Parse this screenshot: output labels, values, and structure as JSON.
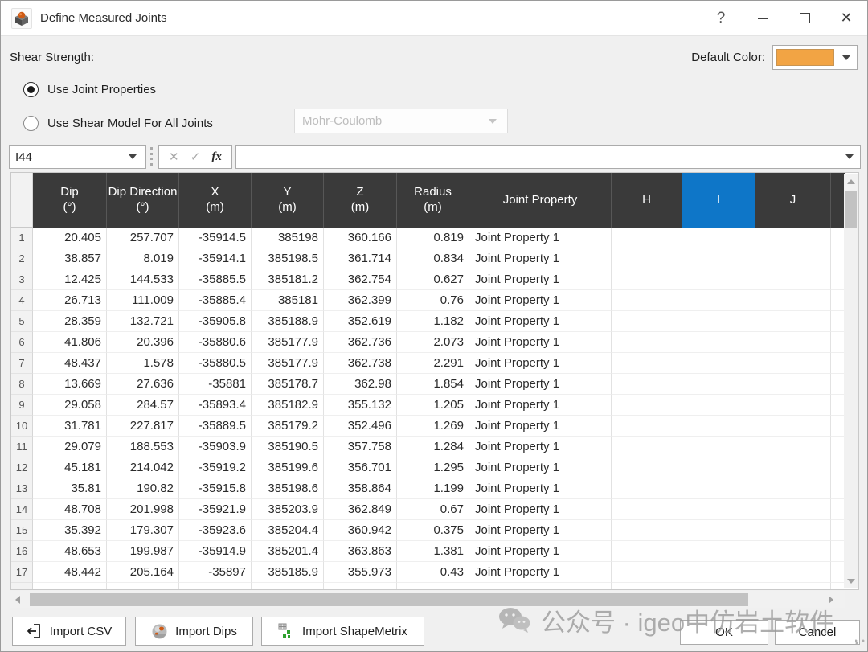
{
  "window": {
    "title": "Define Measured Joints",
    "icons": {
      "help_glyph": "?",
      "close_glyph": "✕",
      "cancel_glyph": "✕",
      "confirm_glyph": "✓"
    }
  },
  "header": {
    "shear_strength_label": "Shear Strength:",
    "default_color_label": "Default Color:",
    "default_color_hex": "#F2A444",
    "radio_use_joint_properties": {
      "label": "Use Joint Properties",
      "selected": true
    },
    "radio_use_shear_model": {
      "label": "Use Shear Model For All Joints",
      "selected": false
    },
    "shear_model_dropdown": {
      "value": "Mohr-Coulomb",
      "disabled": true
    }
  },
  "formula_row": {
    "name_box_value": "I44",
    "fx_label": "fx",
    "formula_bar_value": ""
  },
  "table": {
    "columns": [
      {
        "key": "dip",
        "label": "Dip",
        "unit": "(°)"
      },
      {
        "key": "dip-direction",
        "label": "Dip Direction",
        "unit": "(°)"
      },
      {
        "key": "x",
        "label": "X",
        "unit": "(m)"
      },
      {
        "key": "y",
        "label": "Y",
        "unit": "(m)"
      },
      {
        "key": "z",
        "label": "Z",
        "unit": "(m)"
      },
      {
        "key": "radius",
        "label": "Radius",
        "unit": "(m)"
      },
      {
        "key": "joint-property",
        "label": "Joint Property",
        "unit": ""
      },
      {
        "key": "h",
        "label": "H",
        "unit": ""
      },
      {
        "key": "i",
        "label": "I",
        "unit": "",
        "selected": true
      },
      {
        "key": "j",
        "label": "J",
        "unit": ""
      }
    ],
    "rows": [
      [
        "20.405",
        "257.707",
        "-35914.5",
        "385198",
        "360.166",
        "0.819",
        "Joint Property 1"
      ],
      [
        "38.857",
        "8.019",
        "-35914.1",
        "385198.5",
        "361.714",
        "0.834",
        "Joint Property 1"
      ],
      [
        "12.425",
        "144.533",
        "-35885.5",
        "385181.2",
        "362.754",
        "0.627",
        "Joint Property 1"
      ],
      [
        "26.713",
        "111.009",
        "-35885.4",
        "385181",
        "362.399",
        "0.76",
        "Joint Property 1"
      ],
      [
        "28.359",
        "132.721",
        "-35905.8",
        "385188.9",
        "352.619",
        "1.182",
        "Joint Property 1"
      ],
      [
        "41.806",
        "20.396",
        "-35880.6",
        "385177.9",
        "362.736",
        "2.073",
        "Joint Property 1"
      ],
      [
        "48.437",
        "1.578",
        "-35880.5",
        "385177.9",
        "362.738",
        "2.291",
        "Joint Property 1"
      ],
      [
        "13.669",
        "27.636",
        "-35881",
        "385178.7",
        "362.98",
        "1.854",
        "Joint Property 1"
      ],
      [
        "29.058",
        "284.57",
        "-35893.4",
        "385182.9",
        "355.132",
        "1.205",
        "Joint Property 1"
      ],
      [
        "31.781",
        "227.817",
        "-35889.5",
        "385179.2",
        "352.496",
        "1.269",
        "Joint Property 1"
      ],
      [
        "29.079",
        "188.553",
        "-35903.9",
        "385190.5",
        "357.758",
        "1.284",
        "Joint Property 1"
      ],
      [
        "45.181",
        "214.042",
        "-35919.2",
        "385199.6",
        "356.701",
        "1.295",
        "Joint Property 1"
      ],
      [
        "35.81",
        "190.82",
        "-35915.8",
        "385198.6",
        "358.864",
        "1.199",
        "Joint Property 1"
      ],
      [
        "48.708",
        "201.998",
        "-35921.9",
        "385203.9",
        "362.849",
        "0.67",
        "Joint Property 1"
      ],
      [
        "35.392",
        "179.307",
        "-35923.6",
        "385204.4",
        "360.942",
        "0.375",
        "Joint Property 1"
      ],
      [
        "48.653",
        "199.987",
        "-35914.9",
        "385201.4",
        "363.863",
        "1.381",
        "Joint Property 1"
      ],
      [
        "48.442",
        "205.164",
        "-35897",
        "385185.9",
        "355.973",
        "0.43",
        "Joint Property 1"
      ]
    ],
    "colors": {
      "header_bg": "#3A3A3A",
      "selected_column_bg": "#0E76C8"
    }
  },
  "footer": {
    "import_csv_label": "Import CSV",
    "import_dips_label": "Import Dips",
    "import_shapemetrix_label": "Import ShapeMetrix",
    "ok_label": "OK",
    "cancel_label": "Cancel"
  },
  "watermark": {
    "text": "公众号 · igeo中仿岩土软件"
  }
}
